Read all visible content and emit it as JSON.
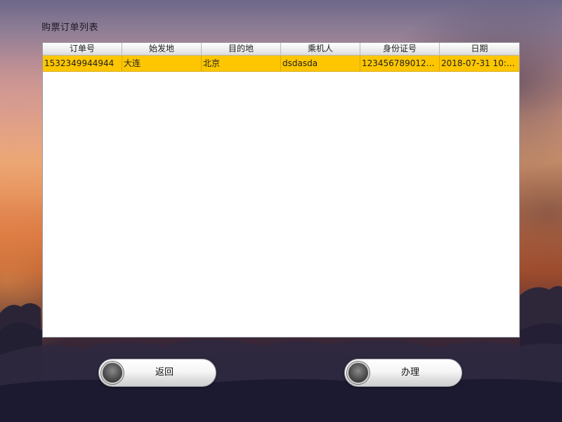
{
  "page": {
    "title": "购票订单列表"
  },
  "table": {
    "columns": [
      "订单号",
      "始发地",
      "目的地",
      "乘机人",
      "身份证号",
      "日期"
    ],
    "rows": [
      [
        "1532349944944",
        "大连",
        "北京",
        "dsdasda",
        "12345678901234…",
        "2018-07-31 10:2…"
      ]
    ]
  },
  "buttons": {
    "back_label": "返回",
    "process_label": "办理"
  },
  "colors": {
    "selected_row": "#fdc600",
    "table_bg": "#ffffff"
  }
}
